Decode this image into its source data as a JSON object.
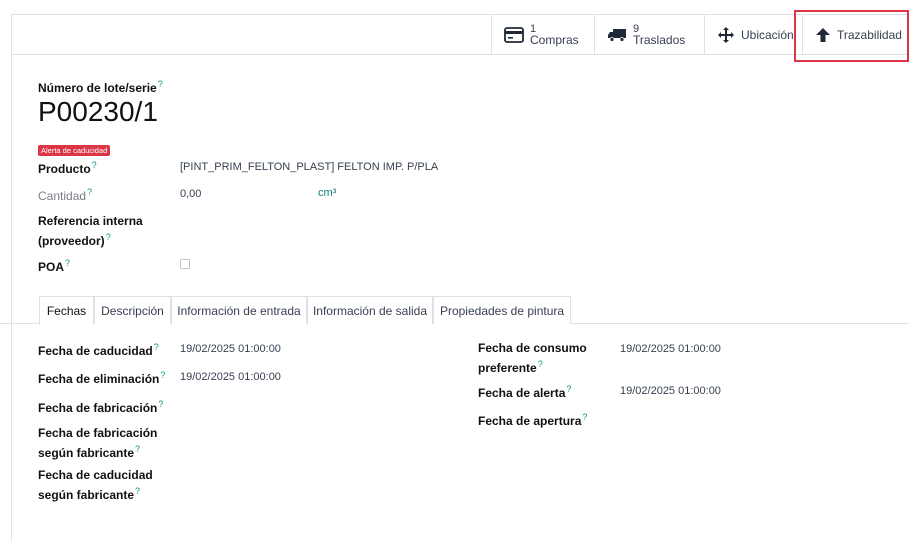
{
  "buttons": {
    "compras": {
      "count": "1",
      "label": "Compras"
    },
    "traslados": {
      "count": "9",
      "label": "Traslados"
    },
    "ubicacion": {
      "label": "Ubicación"
    },
    "trazabilidad": {
      "label": "Trazabilidad"
    }
  },
  "record": {
    "label": "Número de lote/serie",
    "name": "P00230/1",
    "badge": "Alerta de caducidad"
  },
  "fields": {
    "producto": {
      "label": "Producto",
      "value": "[PINT_PRIM_FELTON_PLAST] FELTON IMP. P/PLA"
    },
    "cantidad": {
      "label": "Cantidad",
      "value": "0,00",
      "uom": "cm³"
    },
    "referencia": {
      "label1": "Referencia interna",
      "label2": "(proveedor)"
    },
    "poa": {
      "label": "POA"
    }
  },
  "help_mark": "?",
  "tabs": [
    {
      "label": "Fechas"
    },
    {
      "label": "Descripción"
    },
    {
      "label": "Información de entrada"
    },
    {
      "label": "Información de salida"
    },
    {
      "label": "Propiedades de pintura"
    }
  ],
  "dates_left": {
    "caducidad": {
      "label": "Fecha de caducidad",
      "value": "19/02/2025 01:00:00"
    },
    "eliminacion": {
      "label": "Fecha de eliminación",
      "value": "19/02/2025 01:00:00"
    },
    "fabricacion": {
      "label": "Fecha de fabricación"
    },
    "fab_fabricante": {
      "label1": "Fecha de fabricación",
      "label2": "según fabricante"
    },
    "cad_fabricante": {
      "label1": "Fecha de caducidad",
      "label2": "según fabricante"
    }
  },
  "dates_right": {
    "consumo": {
      "label1": "Fecha de consumo",
      "label2": "preferente",
      "value": "19/02/2025 01:00:00"
    },
    "alerta": {
      "label": "Fecha de alerta",
      "value": "19/02/2025 01:00:00"
    },
    "apertura": {
      "label": "Fecha de apertura"
    }
  },
  "colors": {
    "danger": "#dc3545",
    "teal": "#0d9488"
  }
}
